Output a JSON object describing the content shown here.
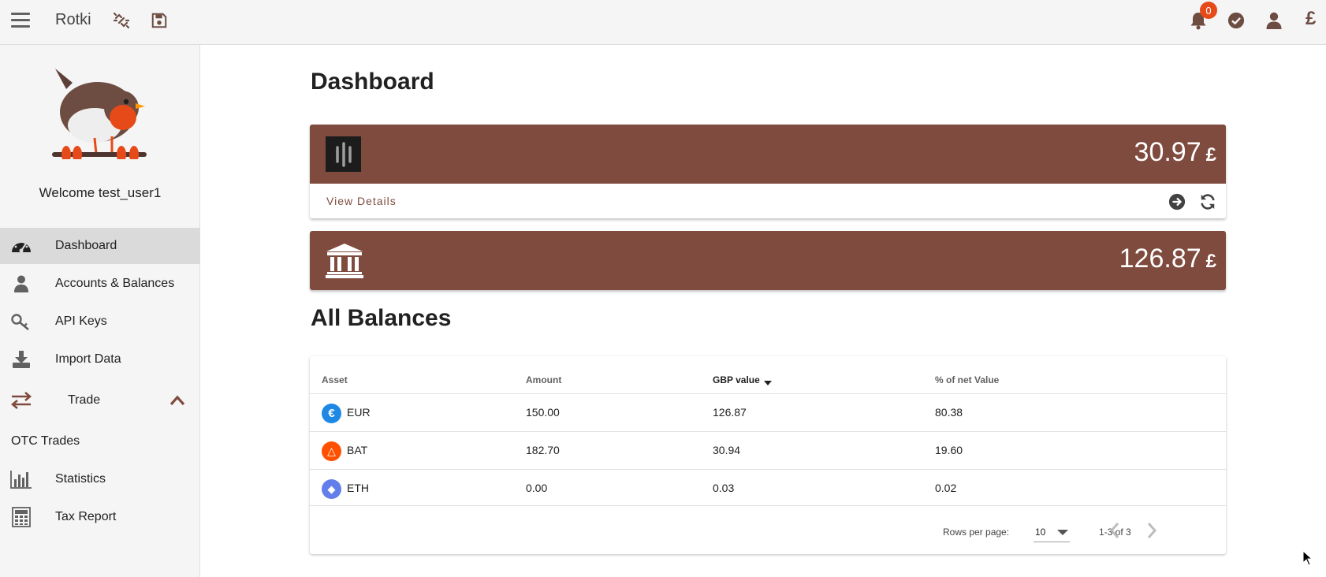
{
  "app": {
    "title": "Rotki",
    "notification_count": "0",
    "currency_symbol": "£",
    "brand_color": "#7f4b3e"
  },
  "sidebar": {
    "welcome": "Welcome test_user1",
    "items": [
      {
        "label": "Dashboard",
        "icon": "dashboard-icon",
        "active": true
      },
      {
        "label": "Accounts & Balances",
        "icon": "user-icon"
      },
      {
        "label": "API Keys",
        "icon": "key-icon"
      },
      {
        "label": "Import Data",
        "icon": "download-icon"
      },
      {
        "label": "Trade",
        "icon": "exchange-icon",
        "expanded": true
      },
      {
        "label": "OTC Trades"
      },
      {
        "label": "Statistics",
        "icon": "bar-chart-icon"
      },
      {
        "label": "Tax Report",
        "icon": "calculator-icon"
      }
    ]
  },
  "main": {
    "title": "Dashboard",
    "cards": [
      {
        "icon": "exchange-logo-icon",
        "value": "30.97",
        "symbol": "£",
        "footer_link": "View Details"
      },
      {
        "icon": "bank-icon",
        "value": "126.87",
        "symbol": "£"
      }
    ],
    "balances": {
      "title": "All Balances",
      "headers": [
        "Asset",
        "Amount",
        "GBP value",
        "% of net Value"
      ],
      "sorted_column": "GBP value",
      "sort_direction": "descending",
      "rows": [
        {
          "asset": "EUR",
          "amount": "150.00",
          "value": "126.87",
          "percent": "80.38",
          "icon_glyph": "€",
          "color": "#1e88e5"
        },
        {
          "asset": "BAT",
          "amount": "182.70",
          "value": "30.94",
          "percent": "19.60",
          "icon_glyph": "△",
          "color": "#ff5000"
        },
        {
          "asset": "ETH",
          "amount": "0.00",
          "value": "0.03",
          "percent": "0.02",
          "icon_glyph": "◆",
          "color": "#627eea"
        }
      ],
      "pagination": {
        "rows_per_page_label": "Rows per page:",
        "rows_per_page": "10",
        "range": "1-3 of 3"
      }
    }
  }
}
